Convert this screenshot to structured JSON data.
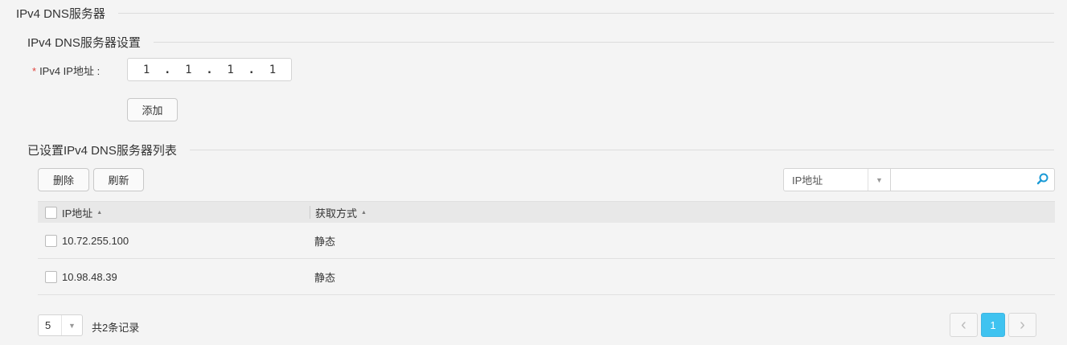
{
  "page": {
    "title": "IPv4 DNS服务器"
  },
  "settings": {
    "title": "IPv4 DNS服务器设置",
    "ip_label": "IPv4 IP地址 :",
    "ip_octets": [
      "1",
      "1",
      "1",
      "1"
    ],
    "add_label": "添加"
  },
  "list": {
    "title": "已设置IPv4 DNS服务器列表",
    "delete_label": "删除",
    "refresh_label": "刷新",
    "filter_field": "IP地址",
    "search_value": "",
    "columns": [
      "IP地址",
      "获取方式"
    ],
    "rows": [
      {
        "ip": "10.72.255.100",
        "method": "静态"
      },
      {
        "ip": "10.98.48.39",
        "method": "静态"
      }
    ]
  },
  "pagination": {
    "page_size": "5",
    "total_text": "共2条记录",
    "current_page": "1",
    "accent_color": "#3fc3f0"
  },
  "icons": {
    "search": "search-icon",
    "prev": "chevron-left-icon",
    "next": "chevron-right-icon",
    "dropdown": "caret-down-icon",
    "sort": "sort-asc-icon"
  }
}
